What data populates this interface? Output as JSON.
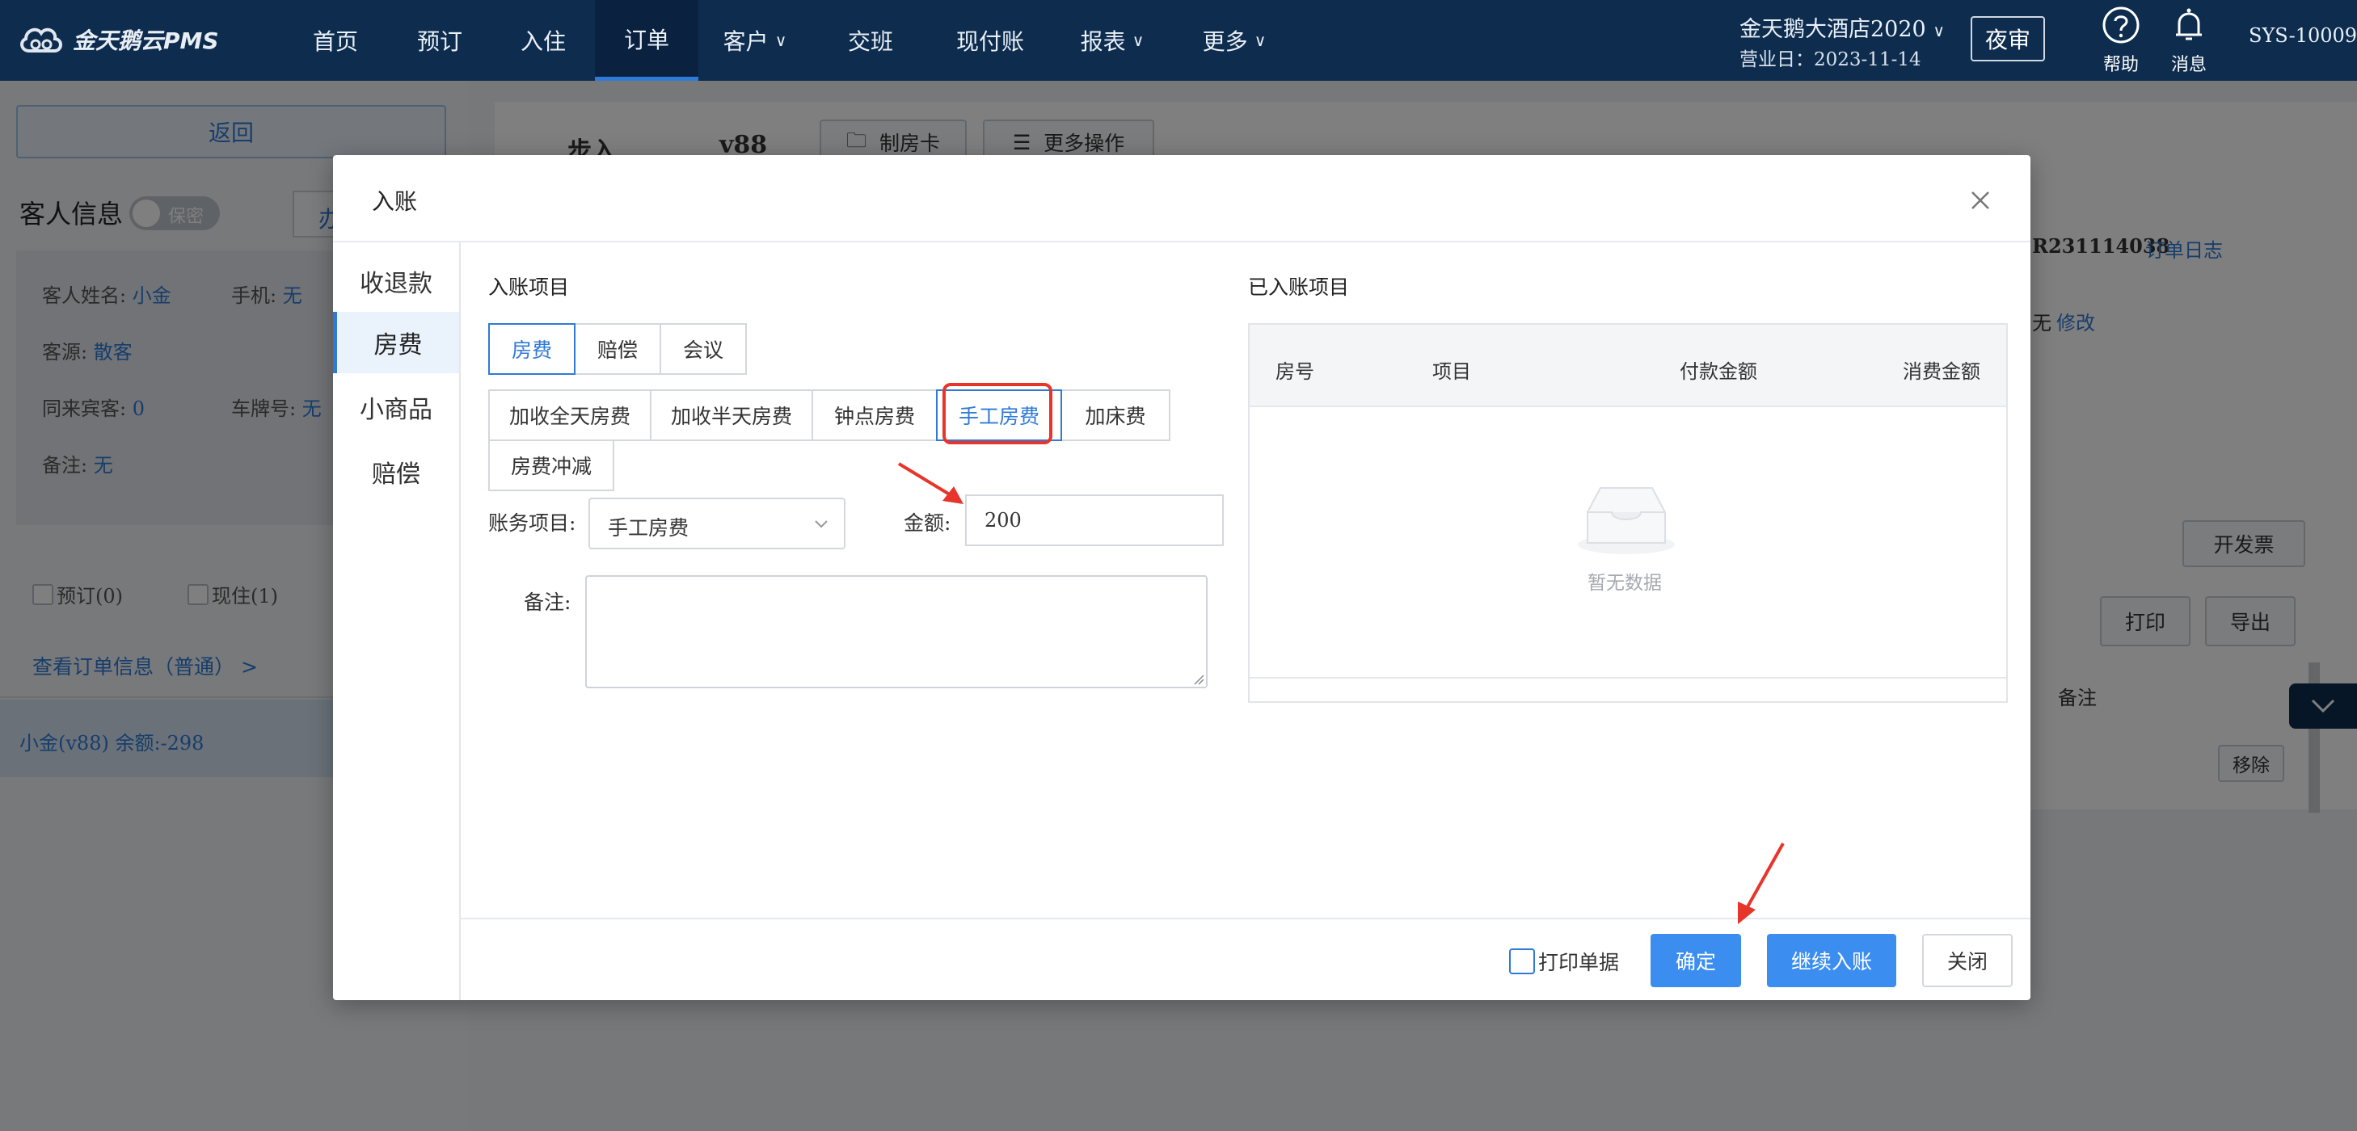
{
  "topbar": {
    "logo_text": "金天鹅云PMS",
    "nav": [
      {
        "label": "首页",
        "caret": false
      },
      {
        "label": "预订",
        "caret": false
      },
      {
        "label": "入住",
        "caret": false
      },
      {
        "label": "订单",
        "caret": false,
        "active": true
      },
      {
        "label": "客户",
        "caret": true
      },
      {
        "label": "交班",
        "caret": false
      },
      {
        "label": "现付账",
        "caret": false
      },
      {
        "label": "报表",
        "caret": true
      },
      {
        "label": "更多",
        "caret": true
      }
    ],
    "hotel_name": "金天鹅大酒店2020",
    "business_day": "营业日：2023-11-14",
    "night_audit": "夜审",
    "help": "帮助",
    "messages": "消息",
    "user": "SYS-10009"
  },
  "left_panel": {
    "back": "返回",
    "guest_info_title": "客人信息",
    "privacy_toggle": "保密",
    "handle_btn": "办",
    "guest_name_label": "客人姓名:",
    "guest_name": "小金",
    "phone_label": "手机:",
    "phone": "无",
    "source_label": "客源:",
    "source": "散客",
    "companions_label": "同来宾客:",
    "companions": "0",
    "plate_label": "车牌号:",
    "plate": "无",
    "note_label": "备注:",
    "note": "无",
    "reserved": "预订(0)",
    "current": "现住(1)",
    "order_link": "查看订单信息（普通） >",
    "room_row": "小金(v88)   余额:-298"
  },
  "main_bg": {
    "step": "步入",
    "room": "v88",
    "make_card": "制房卡",
    "more_ops": "更多操作",
    "order_no": "R231114038",
    "order_log": "订单日志",
    "none": "无",
    "modify": "修改",
    "invoice": "开发票",
    "print": "打印",
    "export": "导出",
    "remark_col": "备注",
    "remove": "移除"
  },
  "modal": {
    "title": "入账",
    "side": [
      "收退款",
      "房费",
      "小商品",
      "赔偿"
    ],
    "side_active": 1,
    "items_title": "入账项目",
    "categories": [
      "房费",
      "赔偿",
      "会议"
    ],
    "subitems": [
      "加收全天房费",
      "加收半天房费",
      "钟点房费",
      "手工房费",
      "加床费",
      "房费冲减"
    ],
    "account_item_label": "账务项目:",
    "account_item_value": "手工房费",
    "amount_label": "金额:",
    "amount_value": "200",
    "remark_label": "备注:",
    "done_title": "已入账项目",
    "columns": [
      "房号",
      "项目",
      "付款金额",
      "消费金额"
    ],
    "empty_text": "暂无数据",
    "print_receipt": "打印单据",
    "confirm": "确定",
    "continue": "继续入账",
    "close": "关闭"
  },
  "colors": {
    "topbar": "#0d2c4e",
    "accent": "#2f7ad7",
    "primary_button": "#3b8ef0",
    "highlight": "#e8352b"
  }
}
